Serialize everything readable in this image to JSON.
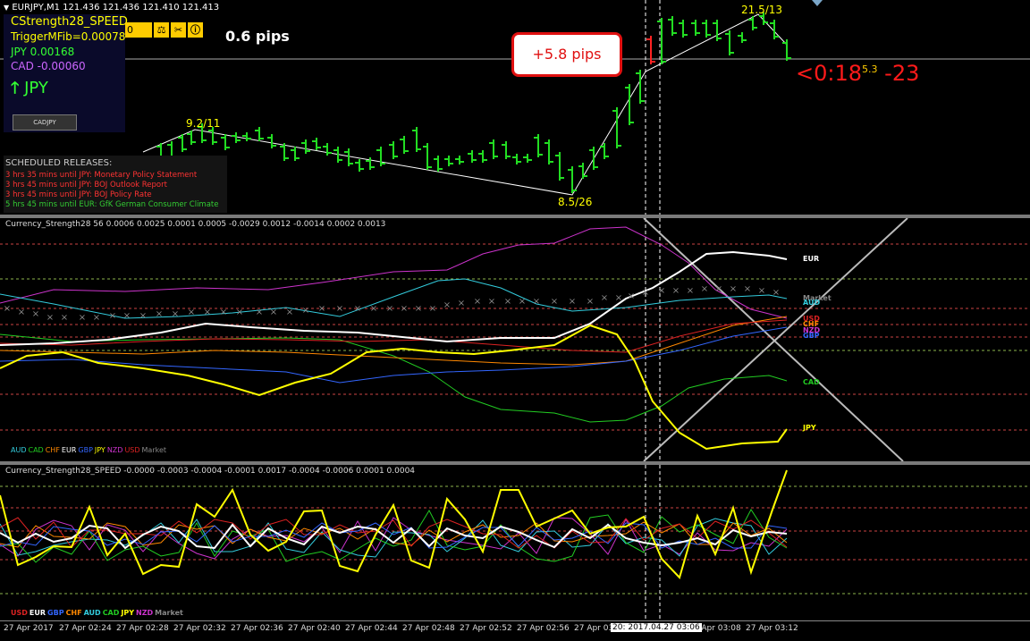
{
  "colors": {
    "bar_green": "#22dd22",
    "bar_red": "#ff2222",
    "yellow": "#ffff00",
    "magenta": "#cc33cc",
    "white": "#ffffff",
    "orange": "#ff8800",
    "cyan": "#33ccdd",
    "blue": "#3366ff",
    "green": "#22cc22",
    "red": "#dd2222",
    "grid_dash": "#ff6666",
    "grid_dash_green": "#9999ff"
  },
  "main": {
    "symbol_header": "EURJPY,M1  121.436 121.436 121.410 121.413",
    "pips_label": "0.6 pips",
    "pips_callout": "+5.8 pips",
    "countdown": "<0:18",
    "countdown_sup": "5.3",
    "countdown_value": "-23",
    "fib_label_1": "9.2/11",
    "fib_label_2": "8.5/26",
    "fib_label_3": "21.5/13",
    "info_panel": {
      "line1": "CStrength28_SPEED",
      "line2": "TriggerMFib=0.00078",
      "line3": "JPY 0.00168",
      "line4": "CAD -0.00060",
      "line5": "JPY",
      "button_label": "CADJPY",
      "toolbar_value": "0"
    },
    "news": {
      "header": "SCHEDULED RELEASES:",
      "items": [
        {
          "text": "3 hrs 35 mins until JPY: Monetary Policy Statement",
          "color": "#ff3333"
        },
        {
          "text": "3 hrs 45 mins until JPY: BOJ Outlook Report",
          "color": "#ff3333"
        },
        {
          "text": "3 hrs 45 mins until JPY: BOJ Policy Rate",
          "color": "#ff3333"
        },
        {
          "text": "5 hrs 45 mins until EUR: GfK German Consumer Climate",
          "color": "#33cc33"
        }
      ]
    }
  },
  "panel1": {
    "header": "Currency_Strength28 56 0.0006 0.0025 0.0001 0.0005 -0.0029 0.0012 -0.0014 0.0002 0.0013",
    "right_labels": [
      {
        "text": "EUR",
        "color": "#ffffff"
      },
      {
        "text": "Market",
        "color": "#888888"
      },
      {
        "text": "AUD",
        "color": "#33ccdd"
      },
      {
        "text": "USD",
        "color": "#dd2222"
      },
      {
        "text": "CHF",
        "color": "#ff8800"
      },
      {
        "text": "NZD",
        "color": "#cc33cc"
      },
      {
        "text": "GBP",
        "color": "#3366ff"
      },
      {
        "text": "CAD",
        "color": "#22cc22"
      },
      {
        "text": "JPY",
        "color": "#ffff00"
      }
    ],
    "legend": [
      {
        "text": "AUD",
        "color": "#33ccdd"
      },
      {
        "text": "CAD",
        "color": "#22cc22"
      },
      {
        "text": "CHF",
        "color": "#ff8800"
      },
      {
        "text": "EUR",
        "color": "#ffffff"
      },
      {
        "text": "GBP",
        "color": "#3366ff"
      },
      {
        "text": "JPY",
        "color": "#ffff00"
      },
      {
        "text": "NZD",
        "color": "#cc33cc"
      },
      {
        "text": "USD",
        "color": "#dd2222"
      },
      {
        "text": "Market",
        "color": "#888888"
      }
    ]
  },
  "panel2": {
    "header": "Currency_Strength28_SPEED  -0.0000 -0.0003 -0.0004 -0.0001 0.0017 -0.0004 -0.0006 0.0001 0.0004",
    "legend": [
      {
        "text": "USD",
        "color": "#dd2222"
      },
      {
        "text": "EUR",
        "color": "#ffffff"
      },
      {
        "text": "GBP",
        "color": "#3366ff"
      },
      {
        "text": "CHF",
        "color": "#ff8800"
      },
      {
        "text": "AUD",
        "color": "#33ccdd"
      },
      {
        "text": "CAD",
        "color": "#22cc22"
      },
      {
        "text": "JPY",
        "color": "#ffff00"
      },
      {
        "text": "NZD",
        "color": "#cc33cc"
      },
      {
        "text": "Market",
        "color": "#888888"
      }
    ]
  },
  "time_axis": {
    "labels": [
      "27 Apr 2017",
      "27 Apr 02:24",
      "27 Apr 02:28",
      "27 Apr 02:32",
      "27 Apr 02:36",
      "27 Apr 02:40",
      "27 Apr 02:44",
      "27 Apr 02:48",
      "27 Apr 02:52",
      "27 Apr 02:56",
      "27 Apr 03",
      "",
      "27 Apr 03:08",
      "27 Apr 03:12"
    ],
    "crosshair_label": "20: 2017.04.27 03:06"
  }
}
